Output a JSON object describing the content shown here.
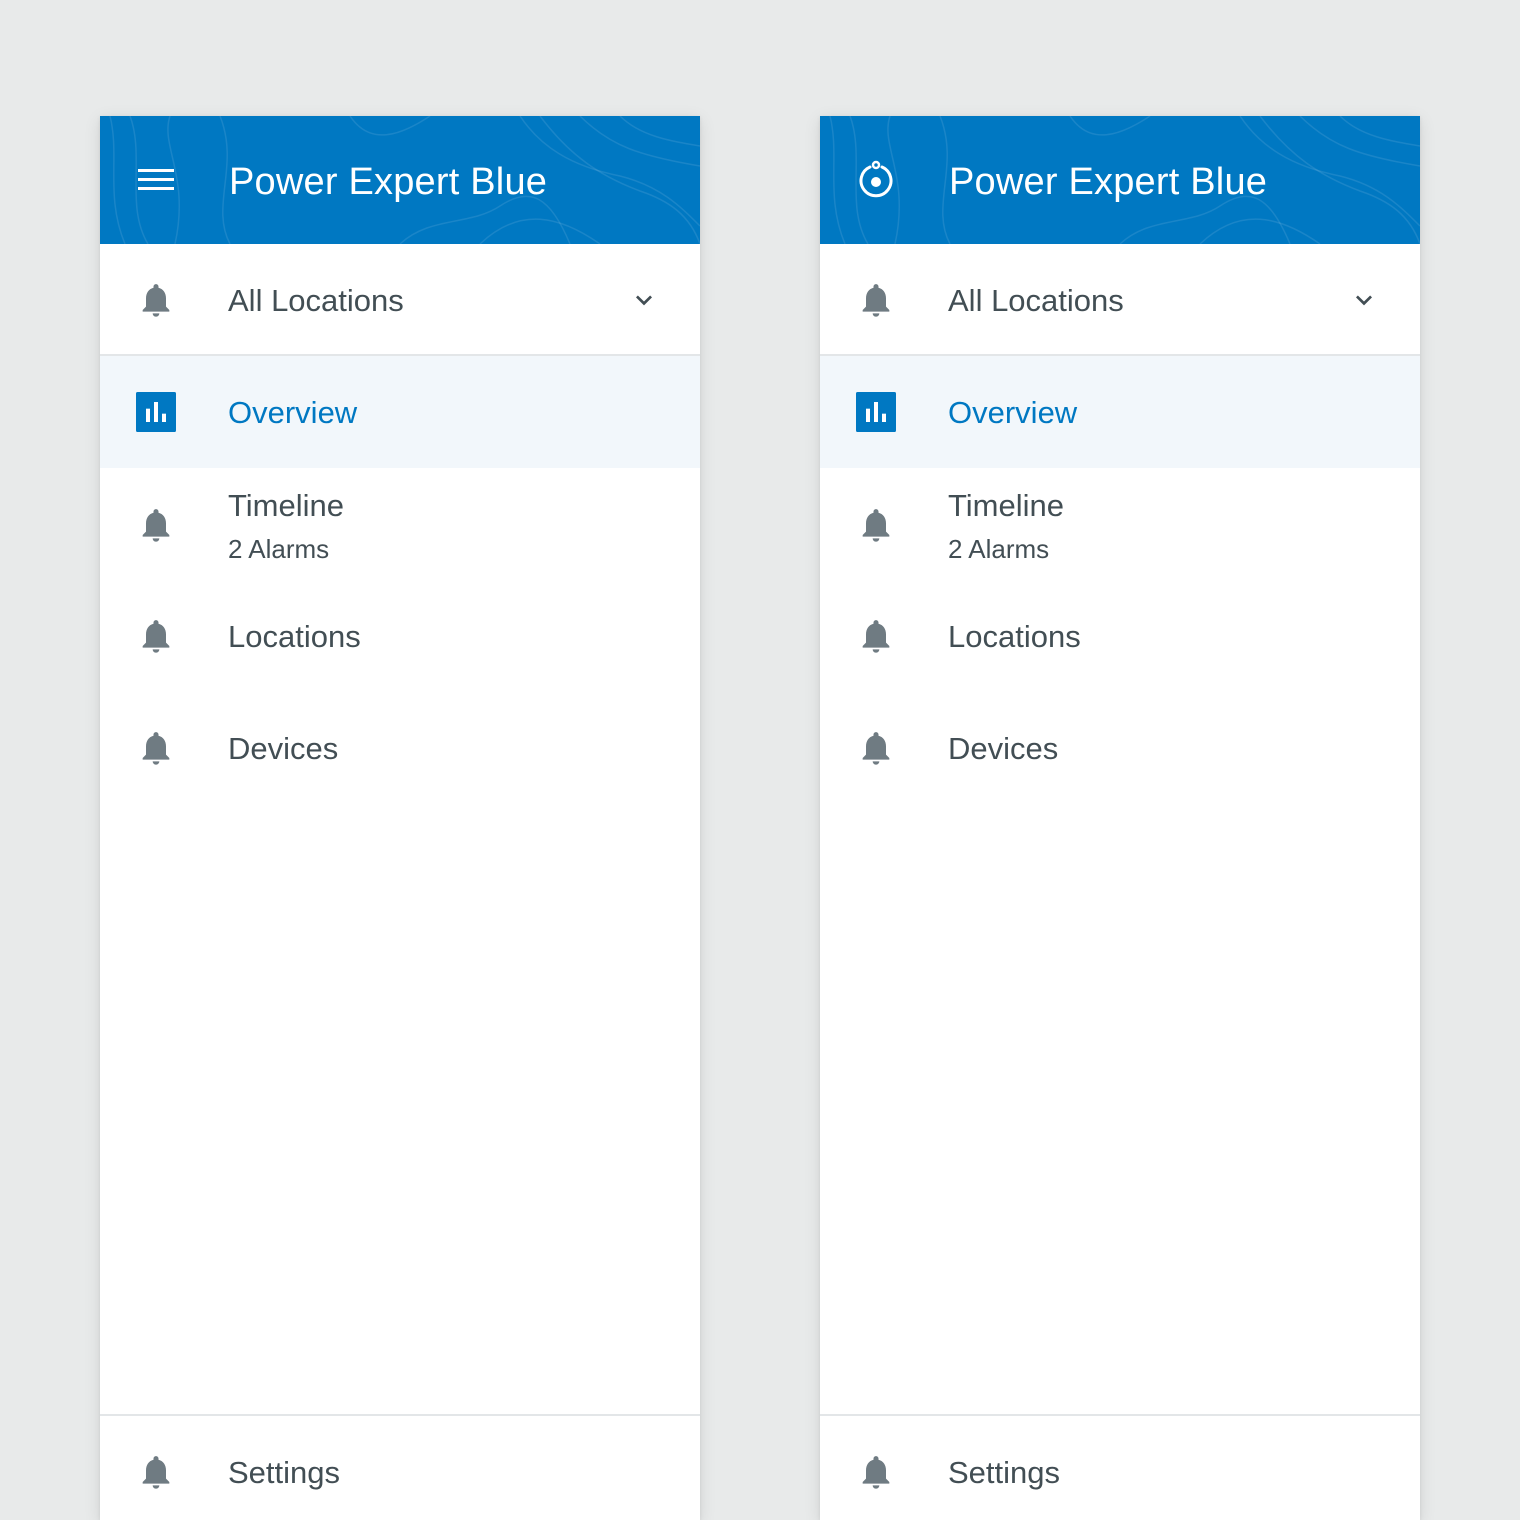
{
  "colors": {
    "brand_blue": "#0078c2",
    "page_background": "#e8eaea",
    "text_gray": "#424e54",
    "icon_gray": "#6f7b82",
    "active_row_background": "#f2f7fb",
    "divider": "#e3e6e8"
  },
  "drawers": [
    {
      "variant": "menu",
      "header": {
        "icon": "hamburger-menu-icon",
        "title": "Power Expert Blue"
      },
      "location_select": {
        "icon": "bell-icon",
        "label": "All Locations",
        "dropdown_icon": "chevron-down-icon"
      },
      "nav": [
        {
          "icon": "bar-chart-icon",
          "label": "Overview",
          "active": true
        },
        {
          "icon": "bell-icon",
          "label": "Timeline",
          "subtitle": "2 Alarms"
        },
        {
          "icon": "bell-icon",
          "label": "Locations"
        },
        {
          "icon": "bell-icon",
          "label": "Devices"
        }
      ],
      "footer": {
        "icon": "bell-icon",
        "label": "Settings"
      }
    },
    {
      "variant": "logo",
      "header": {
        "icon": "app-logo-icon",
        "title": "Power Expert Blue"
      },
      "location_select": {
        "icon": "bell-icon",
        "label": "All Locations",
        "dropdown_icon": "chevron-down-icon"
      },
      "nav": [
        {
          "icon": "bar-chart-icon",
          "label": "Overview",
          "active": true
        },
        {
          "icon": "bell-icon",
          "label": "Timeline",
          "subtitle": "2 Alarms"
        },
        {
          "icon": "bell-icon",
          "label": "Locations"
        },
        {
          "icon": "bell-icon",
          "label": "Devices"
        }
      ],
      "footer": {
        "icon": "bell-icon",
        "label": "Settings"
      }
    }
  ]
}
